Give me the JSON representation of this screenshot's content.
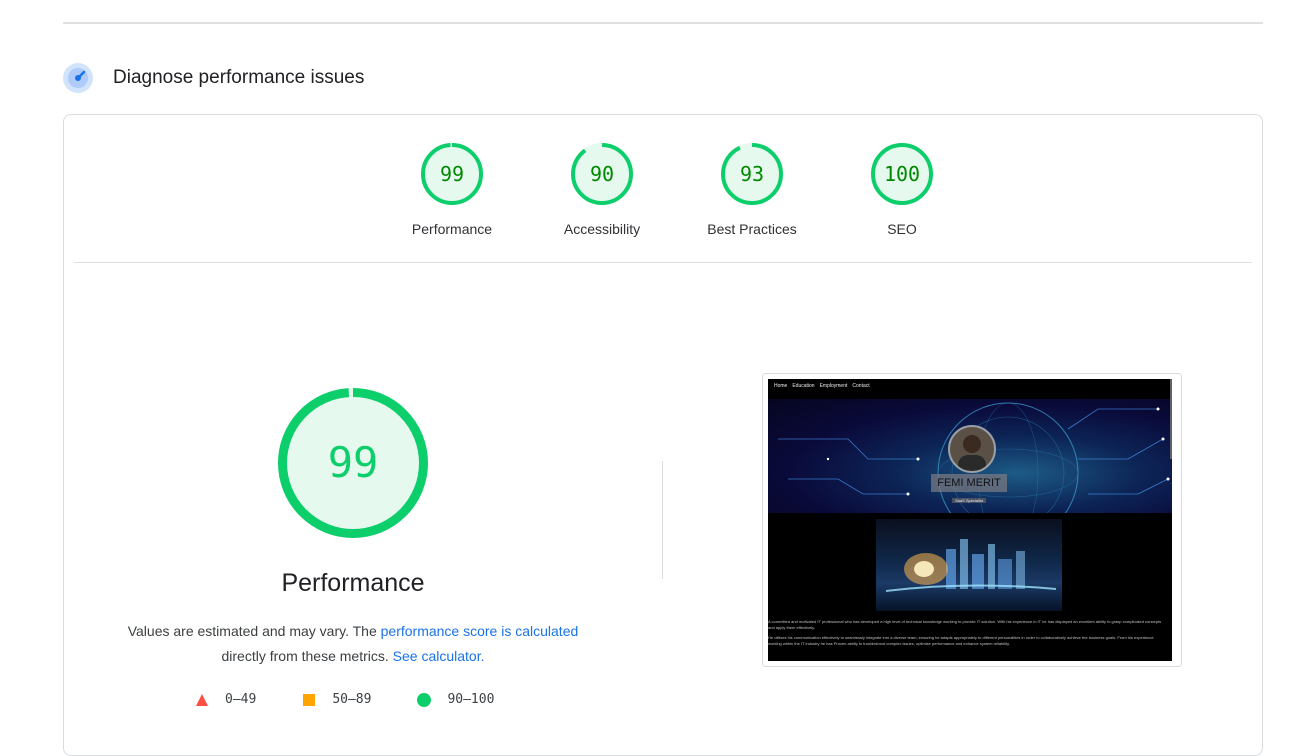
{
  "section": {
    "title": "Diagnose performance issues",
    "icon": "gauge-icon"
  },
  "categories": [
    {
      "label": "Performance",
      "score": 99
    },
    {
      "label": "Accessibility",
      "score": 90
    },
    {
      "label": "Best Practices",
      "score": 93
    },
    {
      "label": "SEO",
      "score": 100
    }
  ],
  "main": {
    "score": 99,
    "title": "Performance",
    "desc_prefix": "Values are estimated and may vary. The ",
    "desc_link1": "performance score is calculated",
    "desc_middle": " directly from these metrics. ",
    "desc_link2": "See calculator."
  },
  "legend": [
    {
      "shape": "triangle-icon",
      "range": "0–49",
      "color": "#ff4e42"
    },
    {
      "shape": "square-icon",
      "range": "50–89",
      "color": "#ffa400"
    },
    {
      "shape": "circle-icon",
      "range": "90–100",
      "color": "#0cce6b"
    }
  ],
  "screenshot": {
    "nav": [
      "Home",
      "Education",
      "Employment",
      "Contact"
    ],
    "name": "FEMI MERIT",
    "role": "SaaS Specialist",
    "para1": "A committed and motivated IT professional who has developed a high level of technical knowledge working to provide IT solution. With his experience in IT he has displayed an excellent ability to grasp complicated concepts and apply them effectively.",
    "para2": "He utilises his communication effectively to seamlessly integrate into a diverse team, ensuring he adapts appropriately to different personalities in order to collaboratively achieve the business goals. From his experience working within the IT industry he has Proven ability to troubleshoot complex issues, optimise performance and enhance system reliability."
  },
  "colors": {
    "pass": "#0cce6b",
    "pass_text": "#008800",
    "pass_fill": "#e6f9ee",
    "link": "#1a73e8"
  }
}
